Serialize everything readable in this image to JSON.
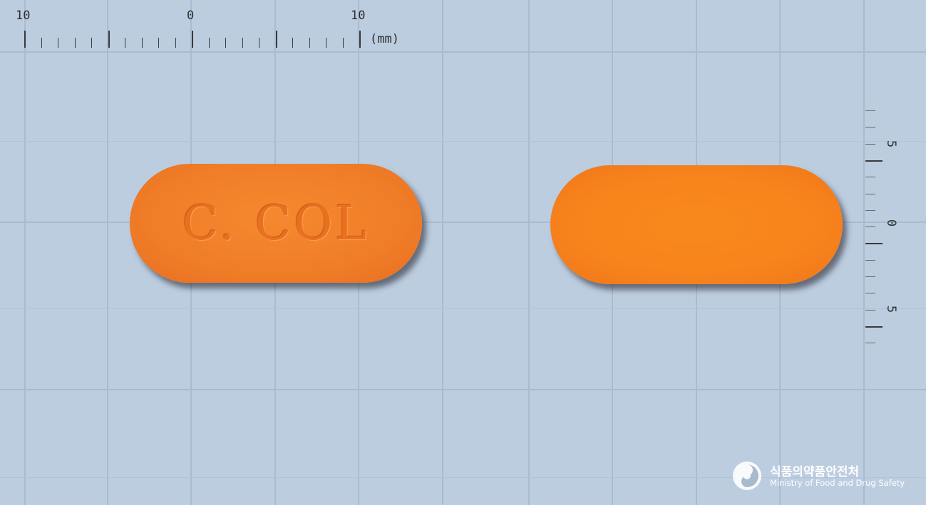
{
  "ruler_horizontal": {
    "labels": [
      "10",
      "0",
      "10"
    ],
    "unit": "(mm)"
  },
  "ruler_vertical": {
    "labels": [
      "5",
      "0",
      "5"
    ]
  },
  "pills": [
    {
      "side": "front",
      "imprint": "C. COL",
      "color": "#f07d28"
    },
    {
      "side": "back",
      "imprint": "",
      "color": "#f7831c"
    }
  ],
  "logo": {
    "korean": "식품의약품안전처",
    "english": "Ministry of Food and Drug Safety"
  }
}
